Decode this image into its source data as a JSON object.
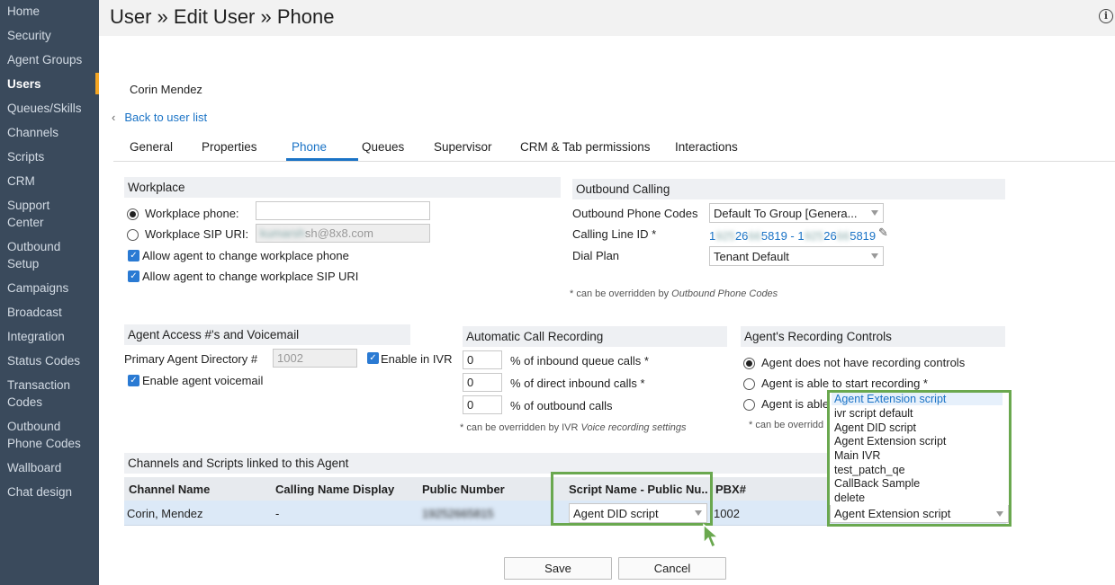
{
  "sidebar": {
    "items": [
      {
        "label": "Home"
      },
      {
        "label": "Security"
      },
      {
        "label": "Agent Groups"
      },
      {
        "label": "Users"
      },
      {
        "label": "Queues/Skills"
      },
      {
        "label": "Channels"
      },
      {
        "label": "Scripts"
      },
      {
        "label": "CRM"
      },
      {
        "label": "Support Center"
      },
      {
        "label": "Outbound Setup"
      },
      {
        "label": "Campaigns"
      },
      {
        "label": "Broadcast"
      },
      {
        "label": "Integration"
      },
      {
        "label": "Status Codes"
      },
      {
        "label": "Transaction Codes"
      },
      {
        "label": "Outbound Phone Codes"
      },
      {
        "label": "Wallboard"
      },
      {
        "label": "Chat design"
      }
    ],
    "accent_color": "#f5a623"
  },
  "header": {
    "title": "User » Edit User » Phone",
    "info_icon": "i"
  },
  "user": {
    "name": "Corin Mendez",
    "back_label": "Back to user list"
  },
  "tabs": [
    {
      "label": "General"
    },
    {
      "label": "Properties"
    },
    {
      "label": "Phone"
    },
    {
      "label": "Queues"
    },
    {
      "label": "Supervisor"
    },
    {
      "label": "CRM & Tab permissions"
    },
    {
      "label": "Interactions"
    }
  ],
  "workplace": {
    "title": "Workplace",
    "phone_label": "Workplace phone:",
    "phone_value": "",
    "sip_label": "Workplace SIP URI:",
    "sip_value_masked": "kumarsh",
    "sip_value_suffix": "sh@8x8.com",
    "allow_phone": "Allow agent to change workplace phone",
    "allow_sip": "Allow agent to change workplace SIP URI"
  },
  "outbound": {
    "title": "Outbound Calling",
    "codes_label": "Outbound Phone Codes",
    "codes_value": "Default To Group [Genera...",
    "cli_label": "Calling Line ID *",
    "cli_a1": "1",
    "cli_a_mask1": "925",
    "cli_a2": "26",
    "cli_a_mask2": "66",
    "cli_a3": "5819 - 1",
    "cli_b_mask1": "925",
    "cli_b2": "26",
    "cli_b_mask2": "66",
    "cli_b3": "5819",
    "dial_label": "Dial Plan",
    "dial_value": "Tenant Default",
    "note_prefix": "* can be overridden by ",
    "note_em": "Outbound Phone Codes"
  },
  "access": {
    "title": "Agent Access #'s and Voicemail",
    "dir_label": "Primary Agent Directory #",
    "dir_value": "1002",
    "ivr_label": "Enable in IVR",
    "voicemail_label": "Enable agent voicemail"
  },
  "recording": {
    "title": "Automatic Call Recording",
    "rows": [
      {
        "value": "0",
        "label": "% of inbound queue calls *"
      },
      {
        "value": "0",
        "label": "% of direct inbound calls *"
      },
      {
        "value": "0",
        "label": "% of outbound calls"
      }
    ],
    "note_prefix": "* can be overridden by IVR ",
    "note_em": "Voice recording settings"
  },
  "controls": {
    "title": "Agent's Recording Controls",
    "opt1": "Agent does not have recording controls",
    "opt2": "Agent is able to start recording *",
    "opt3": "Agent is able",
    "note": "* can be overridd"
  },
  "channels": {
    "title": "Channels and Scripts linked to this Agent",
    "columns": [
      "Channel Name",
      "Calling Name Display",
      "Public Number",
      "Script Name - Public Nu...",
      "PBX#"
    ],
    "row": {
      "channel": "Corin, Mendez",
      "calling_name": "-",
      "public_number": "19252665815",
      "script": "Agent DID script",
      "pbx": "1002",
      "pbx_script": "Agent Extension script"
    },
    "dropdown_options": [
      "Agent Extension script",
      "ivr script default",
      "Agent DID script",
      "Agent Extension script",
      "Main IVR",
      "test_patch_qe",
      "CallBack Sample",
      "delete"
    ],
    "highlight_color": "#6aa84f"
  },
  "buttons": {
    "save": "Save",
    "cancel": "Cancel"
  }
}
